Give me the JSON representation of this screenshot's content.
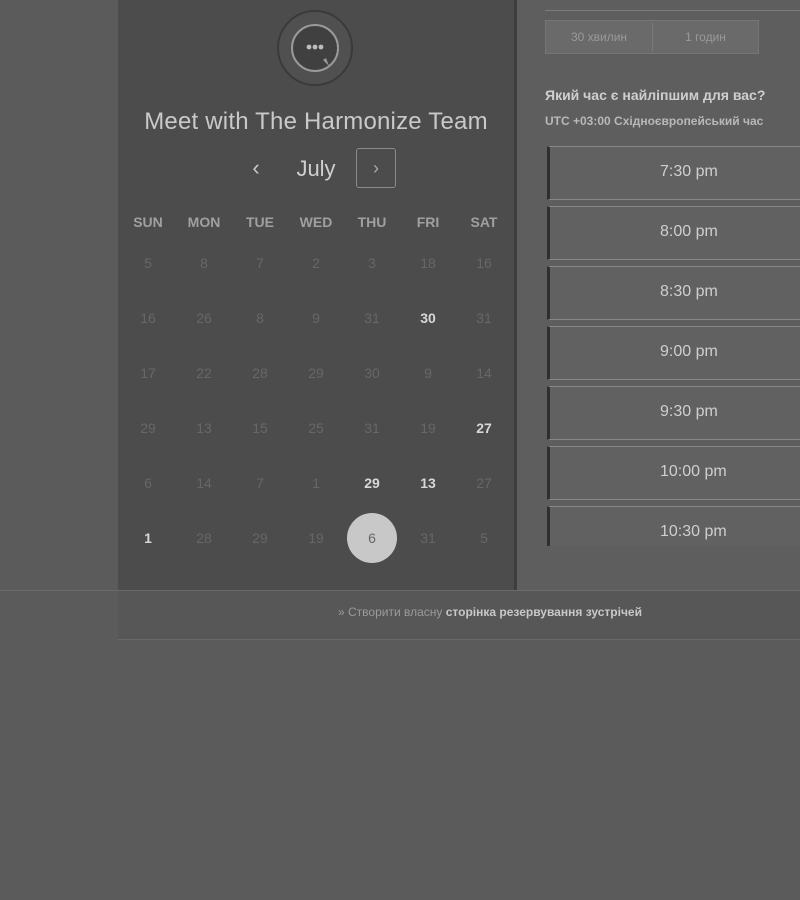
{
  "title": "Meet with The Harmonize Team",
  "calendar": {
    "month": "July",
    "prev_icon": "‹",
    "next_icon": "›",
    "weekdays": [
      "SUN",
      "MON",
      "TUE",
      "WED",
      "THU",
      "FRI",
      "SAT"
    ],
    "weeks": [
      [
        {
          "d": "5",
          "a": false
        },
        {
          "d": "8",
          "a": false
        },
        {
          "d": "7",
          "a": false
        },
        {
          "d": "2",
          "a": false
        },
        {
          "d": "3",
          "a": false
        },
        {
          "d": "18",
          "a": false
        },
        {
          "d": "16",
          "a": false
        }
      ],
      [
        {
          "d": "16",
          "a": false
        },
        {
          "d": "26",
          "a": false
        },
        {
          "d": "8",
          "a": false
        },
        {
          "d": "9",
          "a": false
        },
        {
          "d": "31",
          "a": false
        },
        {
          "d": "30",
          "a": true
        },
        {
          "d": "31",
          "a": false
        }
      ],
      [
        {
          "d": "17",
          "a": false
        },
        {
          "d": "22",
          "a": false
        },
        {
          "d": "28",
          "a": false
        },
        {
          "d": "29",
          "a": false
        },
        {
          "d": "30",
          "a": false
        },
        {
          "d": "9",
          "a": false
        },
        {
          "d": "14",
          "a": false
        }
      ],
      [
        {
          "d": "29",
          "a": false
        },
        {
          "d": "13",
          "a": false
        },
        {
          "d": "15",
          "a": false
        },
        {
          "d": "25",
          "a": false
        },
        {
          "d": "31",
          "a": false
        },
        {
          "d": "19",
          "a": false
        },
        {
          "d": "27",
          "a": true
        }
      ],
      [
        {
          "d": "6",
          "a": false
        },
        {
          "d": "14",
          "a": false
        },
        {
          "d": "7",
          "a": false
        },
        {
          "d": "1",
          "a": false
        },
        {
          "d": "29",
          "a": true
        },
        {
          "d": "13",
          "a": true
        },
        {
          "d": "27",
          "a": false
        }
      ],
      [
        {
          "d": "1",
          "a": true
        },
        {
          "d": "28",
          "a": false
        },
        {
          "d": "29",
          "a": false
        },
        {
          "d": "19",
          "a": false
        },
        {
          "d": "6",
          "a": true,
          "s": true
        },
        {
          "d": "31",
          "a": false
        },
        {
          "d": "5",
          "a": false
        }
      ]
    ]
  },
  "duration": {
    "options": [
      "30 хвилин",
      "1 годин"
    ]
  },
  "question": "Який час є найліпшим для вас?",
  "timezone": "UTC +03:00 Східноєвропейський час",
  "slots": [
    "7:30 pm",
    "8:00 pm",
    "8:30 pm",
    "9:00 pm",
    "9:30 pm",
    "10:00 pm",
    "10:30 pm"
  ],
  "footer": {
    "prefix": "Створити власну",
    "bold": "сторінка резервування зустрічей"
  }
}
